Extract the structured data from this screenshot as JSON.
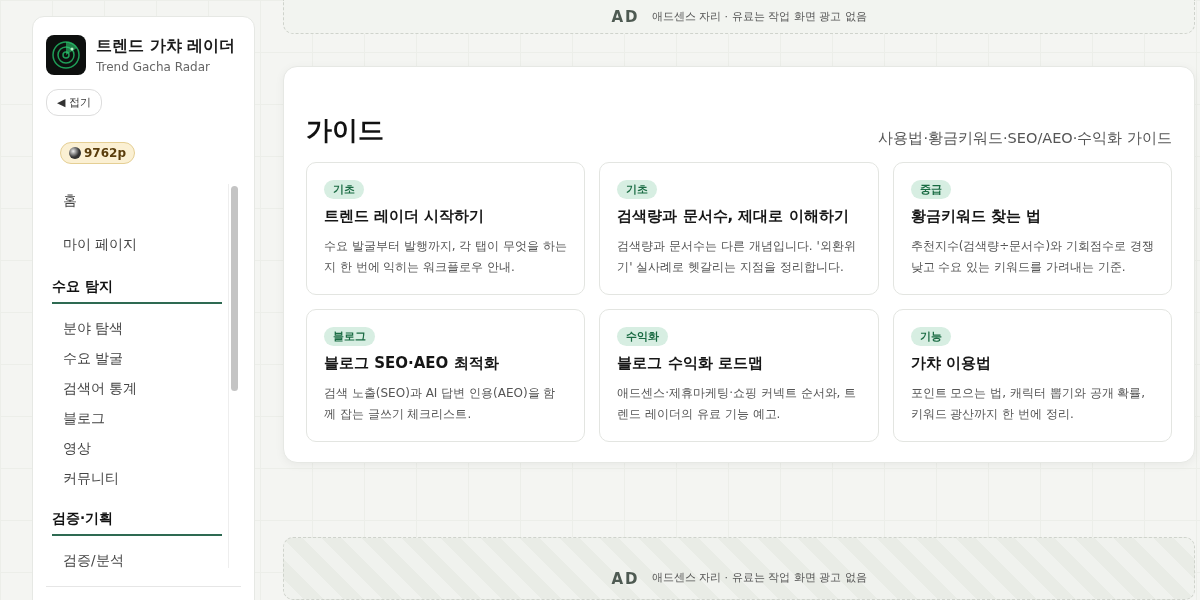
{
  "brand": {
    "title": "트렌드 가챠 레이더",
    "subtitle": "Trend Gacha Radar"
  },
  "collapse_button": "◀ 접기",
  "points": "9762p",
  "nav": [
    {
      "kind": "link",
      "label": "홈"
    },
    {
      "kind": "link",
      "label": "마이 페이지"
    },
    {
      "kind": "heading",
      "label": "수요 탐지"
    },
    {
      "kind": "sublink",
      "label": "분야 탐색"
    },
    {
      "kind": "sublink",
      "label": "수요 발굴"
    },
    {
      "kind": "sublink",
      "label": "검색어 통계"
    },
    {
      "kind": "sublink",
      "label": "블로그"
    },
    {
      "kind": "sublink",
      "label": "영상"
    },
    {
      "kind": "sublink",
      "label": "커뮤니티"
    },
    {
      "kind": "heading",
      "label": "검증·기획"
    },
    {
      "kind": "sublink",
      "label": "검증/분석"
    }
  ],
  "ads": [
    {
      "label": "AD",
      "text": "애드센스 자리 · 유료는 작업 화면 광고 없음",
      "striped": false
    },
    {
      "label": "AD",
      "text": "애드센스 자리 · 유료는 작업 화면 광고 없음",
      "striped": true
    }
  ],
  "guide": {
    "title": "가이드",
    "subtitle": "사용법·황금키워드·SEO/AEO·수익화 가이드",
    "cards": [
      {
        "tag": "기초",
        "title": "트렌드 레이더 시작하기",
        "desc": "수요 발굴부터 발행까지, 각 탭이 무엇을 하는지 한 번에 익히는 워크플로우 안내."
      },
      {
        "tag": "기초",
        "title": "검색량과 문서수, 제대로 이해하기",
        "desc": "검색량과 문서수는 다른 개념입니다. '외환위기' 실사례로 헷갈리는 지점을 정리합니다."
      },
      {
        "tag": "중급",
        "title": "황금키워드 찾는 법",
        "desc": "추천지수(검색량÷문서수)와 기회점수로 경쟁 낮고 수요 있는 키워드를 가려내는 기준."
      },
      {
        "tag": "블로그",
        "title": "블로그 SEO·AEO 최적화",
        "desc": "검색 노출(SEO)과 AI 답변 인용(AEO)을 함께 잡는 글쓰기 체크리스트."
      },
      {
        "tag": "수익화",
        "title": "블로그 수익화 로드맵",
        "desc": "애드센스·제휴마케팅·쇼핑 커넥트 순서와, 트렌드 레이더의 유료 기능 예고."
      },
      {
        "tag": "기능",
        "title": "가챠 이용법",
        "desc": "포인트 모으는 법, 캐릭터 뽑기와 공개 확률, 키워드 광산까지 한 번에 정리."
      }
    ]
  }
}
